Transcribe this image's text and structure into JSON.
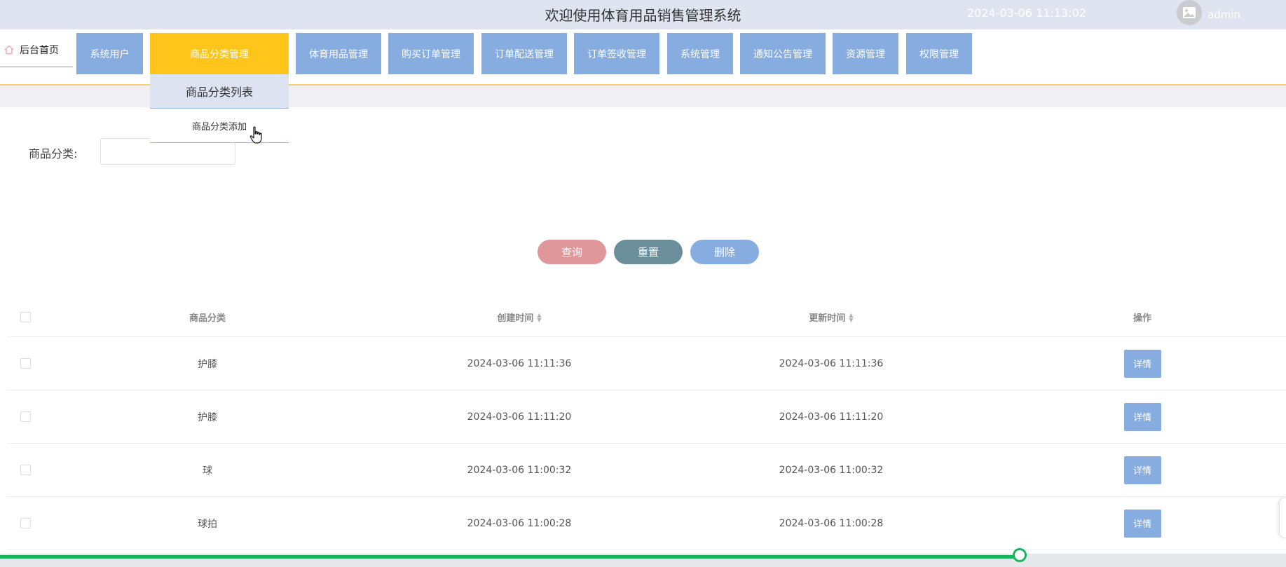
{
  "header": {
    "title": "欢迎使用体育用品销售管理系统",
    "time": "2024-03-06 11:13:02",
    "username": "admin"
  },
  "nav": {
    "home": "后台首页",
    "items": [
      {
        "label": "系统用户",
        "active": false
      },
      {
        "label": "商品分类管理",
        "active": true
      },
      {
        "label": "体育用品管理",
        "active": false
      },
      {
        "label": "购买订单管理",
        "active": false
      },
      {
        "label": "订单配送管理",
        "active": false
      },
      {
        "label": "订单签收管理",
        "active": false
      },
      {
        "label": "系统管理",
        "active": false
      },
      {
        "label": "通知公告管理",
        "active": false
      },
      {
        "label": "资源管理",
        "active": false
      },
      {
        "label": "权限管理",
        "active": false
      }
    ],
    "dropdown": [
      "商品分类列表",
      "商品分类添加"
    ]
  },
  "search": {
    "label": "商品分类:",
    "value": ""
  },
  "buttons": {
    "query": "查询",
    "reset": "重置",
    "delete": "删除"
  },
  "table": {
    "columns": [
      "商品分类",
      "创建时间",
      "更新时间",
      "操作"
    ],
    "rows": [
      {
        "category": "护膝",
        "created": "2024-03-06 11:11:36",
        "updated": "2024-03-06 11:11:36",
        "action": "详情"
      },
      {
        "category": "护膝",
        "created": "2024-03-06 11:11:20",
        "updated": "2024-03-06 11:11:20",
        "action": "详情"
      },
      {
        "category": "球",
        "created": "2024-03-06 11:00:32",
        "updated": "2024-03-06 11:00:32",
        "action": "详情"
      },
      {
        "category": "球拍",
        "created": "2024-03-06 11:00:28",
        "updated": "2024-03-06 11:00:28",
        "action": "详情"
      }
    ]
  },
  "progress": {
    "fraction": 0.793
  },
  "colors": {
    "header_bg": "#dfe4f0",
    "nav_blue": "#86ace0",
    "nav_active": "#ffc51b",
    "query_btn": "#e0979c",
    "reset_btn": "#6b8e9b",
    "delete_btn": "#86ace0",
    "progress": "#1bb35b"
  },
  "icons": {
    "home": "home-icon",
    "avatar": "image-icon",
    "sort": "sort-caret-icon",
    "cursor": "hand-pointer-icon"
  }
}
